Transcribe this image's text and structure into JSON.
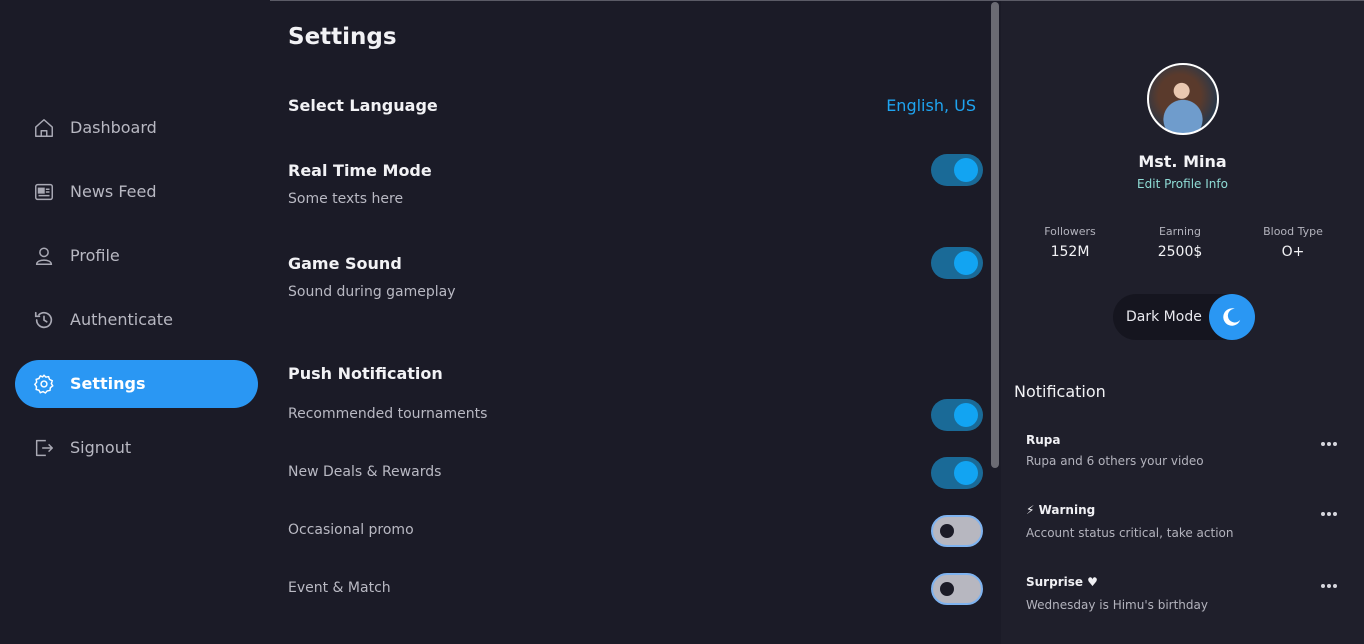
{
  "sidebar": {
    "items": [
      {
        "label": "Dashboard",
        "icon": "home-icon"
      },
      {
        "label": "News Feed",
        "icon": "newspaper-icon"
      },
      {
        "label": "Profile",
        "icon": "user-icon"
      },
      {
        "label": "Authenticate",
        "icon": "history-icon"
      },
      {
        "label": "Settings",
        "icon": "gear-icon",
        "active": true
      },
      {
        "label": "Signout",
        "icon": "signout-icon"
      }
    ]
  },
  "main": {
    "title": "Settings",
    "language": {
      "label": "Select Language",
      "value": "English, US"
    },
    "real_time": {
      "title": "Real Time Mode",
      "subtitle": "Some texts here",
      "enabled": true
    },
    "game_sound": {
      "title": "Game Sound",
      "subtitle": "Sound during gameplay",
      "enabled": true
    },
    "push": {
      "title": "Push Notification",
      "items": [
        {
          "label": "Recommended tournaments",
          "enabled": true
        },
        {
          "label": "New Deals & Rewards",
          "enabled": true
        },
        {
          "label": "Occasional promo",
          "enabled": false
        },
        {
          "label": "Event & Match",
          "enabled": false
        }
      ]
    }
  },
  "profile": {
    "name": "Mst. Mina",
    "edit_label": "Edit Profile Info",
    "stats": [
      {
        "label": "Followers",
        "value": "152M"
      },
      {
        "label": "Earning",
        "value": "2500$"
      },
      {
        "label": "Blood Type",
        "value": "O+"
      }
    ],
    "dark_mode_label": "Dark Mode"
  },
  "notifications": {
    "title": "Notification",
    "items": [
      {
        "title": "Rupa",
        "desc": "Rupa and 6 others your video"
      },
      {
        "title": "⚡ Warning",
        "desc": "Account status critical, take action"
      },
      {
        "title": "Surprise ♥",
        "desc": "Wednesday is Himu's birthday"
      }
    ]
  },
  "colors": {
    "accent": "#2a97f3",
    "toggle_on_track": "#1a6a97",
    "toggle_on_knob": "#12a4f2",
    "background": "#1b1b27",
    "panel": "#1f1f2b"
  }
}
